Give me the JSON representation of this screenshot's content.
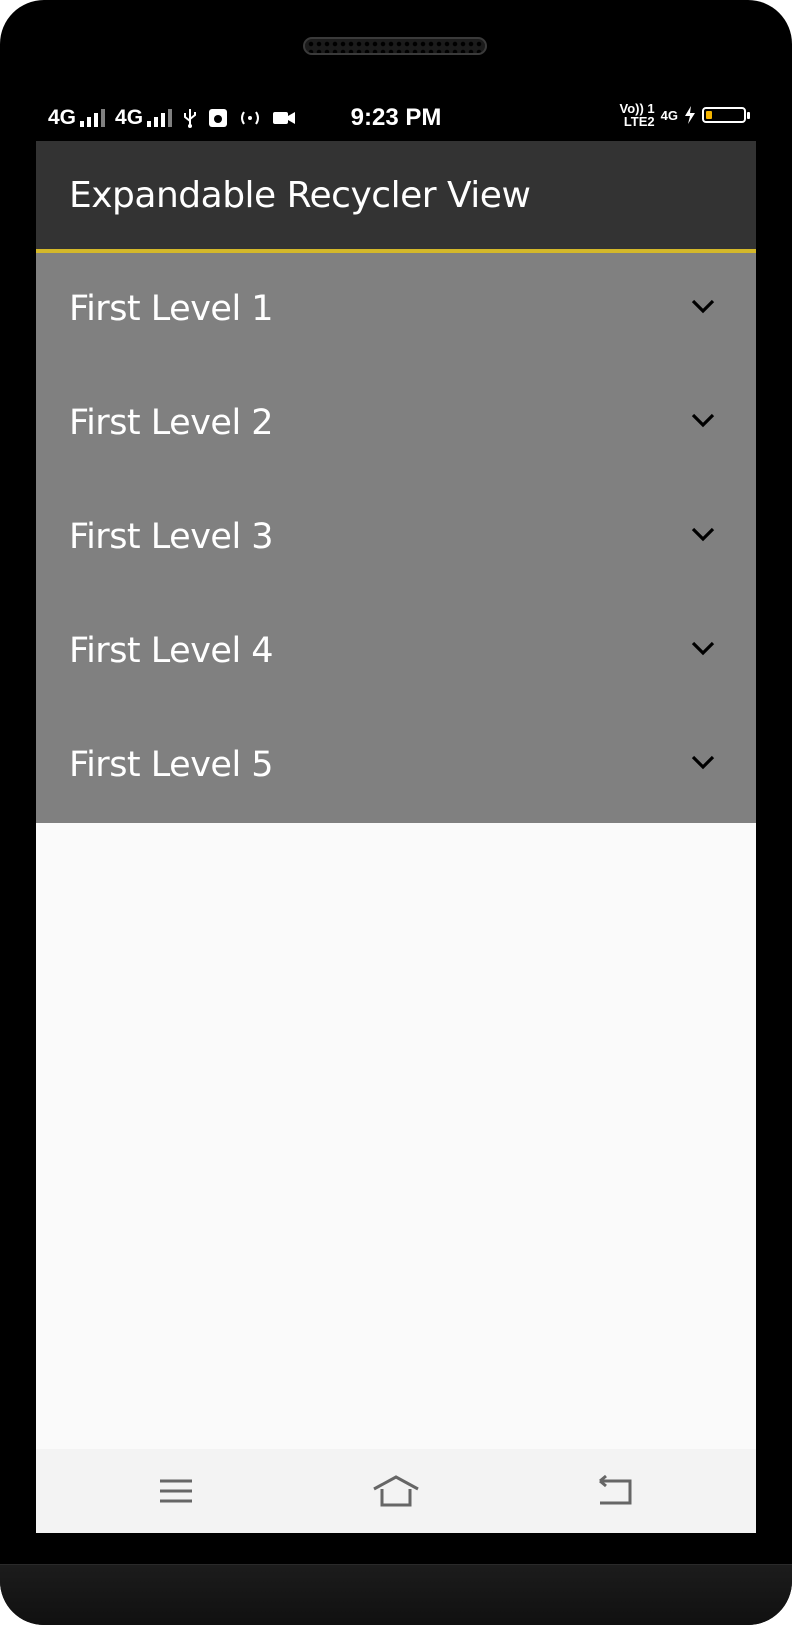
{
  "status_bar": {
    "time": "9:23 PM",
    "sim1_network": "4G",
    "sim2_network": "4G",
    "right_top": "Vo)) 1",
    "right_bottom": "LTE2",
    "right_network": "4G",
    "icons": [
      "signal-icon",
      "usb-icon",
      "debug-icon",
      "hotspot-icon",
      "video-icon",
      "charging-icon",
      "battery-icon"
    ],
    "battery_level": 0.15,
    "battery_color": "#f4b400"
  },
  "app_bar": {
    "title": "Expandable Recycler View",
    "background": "#333333",
    "accent": "#d4b82a"
  },
  "list": {
    "background": "#808080",
    "items": [
      {
        "label": "First Level 1",
        "icon": "chevron-down-icon"
      },
      {
        "label": "First Level 2",
        "icon": "chevron-down-icon"
      },
      {
        "label": "First Level 3",
        "icon": "chevron-down-icon"
      },
      {
        "label": "First Level 4",
        "icon": "chevron-down-icon"
      },
      {
        "label": "First Level 5",
        "icon": "chevron-down-icon"
      }
    ]
  },
  "nav_bar": {
    "buttons": [
      "menu-icon",
      "home-icon",
      "back-icon"
    ]
  }
}
